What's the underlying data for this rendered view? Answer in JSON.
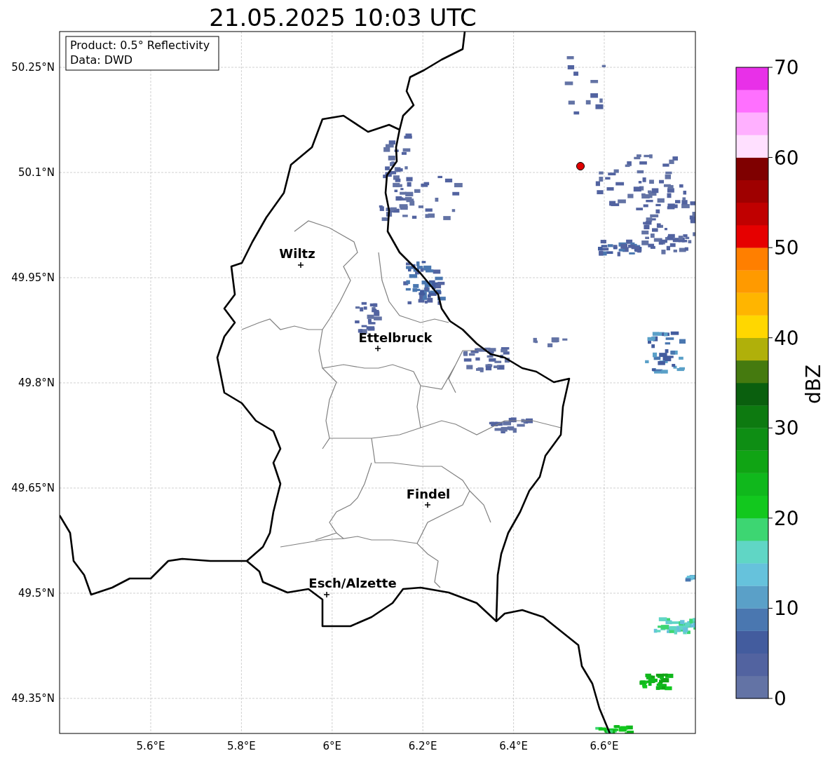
{
  "title": "21.05.2025 10:03 UTC",
  "info_box": [
    "Product: 0.5° Reflectivity",
    "Data: DWD"
  ],
  "map": {
    "y_ticks": [
      "50.25°N",
      "50.1°N",
      "49.95°N",
      "49.8°N",
      "49.65°N",
      "49.5°N",
      "49.35°N"
    ],
    "x_ticks": [
      "5.6°E",
      "5.8°E",
      "6°E",
      "6.2°E",
      "6.4°E",
      "6.6°E"
    ],
    "places": [
      {
        "name": "Wiltz"
      },
      {
        "name": "Ettelbruck"
      },
      {
        "name": "Findel"
      },
      {
        "name": "Esch/Alzette"
      }
    ]
  },
  "colorbar": {
    "label": "dBZ",
    "ticks": [
      "70",
      "60",
      "50",
      "40",
      "30",
      "20",
      "10",
      "0"
    ],
    "bins": [
      {
        "color": "#6373a5"
      },
      {
        "color": "#5263a0"
      },
      {
        "color": "#435c9e"
      },
      {
        "color": "#4a77b0"
      },
      {
        "color": "#5aa0c8"
      },
      {
        "color": "#66c2dc"
      },
      {
        "color": "#60d6c5"
      },
      {
        "color": "#3dd672"
      },
      {
        "color": "#12c81e"
      },
      {
        "color": "#10b81c"
      },
      {
        "color": "#10a414"
      },
      {
        "color": "#0e8e14"
      },
      {
        "color": "#0d7a10"
      },
      {
        "color": "#0a5f0e"
      },
      {
        "color": "#457a0f"
      },
      {
        "color": "#b0b00a"
      },
      {
        "color": "#ffd700"
      },
      {
        "color": "#ffb500"
      },
      {
        "color": "#ff9a00"
      },
      {
        "color": "#ff7f00"
      },
      {
        "color": "#e60000"
      },
      {
        "color": "#c00000"
      },
      {
        "color": "#9f0000"
      },
      {
        "color": "#7f0000"
      },
      {
        "color": "#ffe0ff"
      },
      {
        "color": "#ffb0ff"
      },
      {
        "color": "#ff70ff"
      },
      {
        "color": "#e830e8"
      }
    ]
  }
}
